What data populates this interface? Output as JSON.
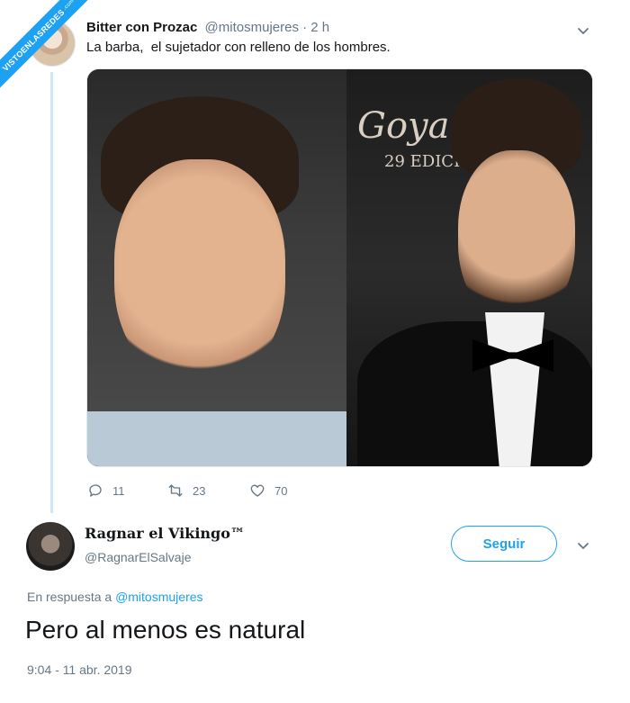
{
  "watermark": {
    "text": "VISTOENLASREDES",
    "suffix": ".com"
  },
  "tweet1": {
    "name": "Bitter con Prozac",
    "meta": "@mitosmujeres · 2 h",
    "text": "La barba,  el sujetador con relleno de los hombres.",
    "photo_text": {
      "logo": "Goya",
      "logo_sub": "29 EDICIÓN"
    },
    "actions": {
      "replies": "11",
      "retweets": "23",
      "likes": "70"
    }
  },
  "tweet2": {
    "name": "Ragnar el Vikingo™",
    "handle": "@RagnarElSalvaje",
    "follow_label": "Seguir",
    "reply_prefix": "En respuesta a",
    "reply_mention": "@mitosmujeres",
    "text": "Pero al menos es natural",
    "timestamp": "9:04 - 11 abr. 2019"
  },
  "colors": {
    "accent": "#1da1f2",
    "text": "#14171a",
    "muted": "#657786",
    "thread": "#cfe6fa"
  },
  "icons": [
    "chevron-down-icon",
    "reply-icon",
    "retweet-icon",
    "like-icon"
  ]
}
